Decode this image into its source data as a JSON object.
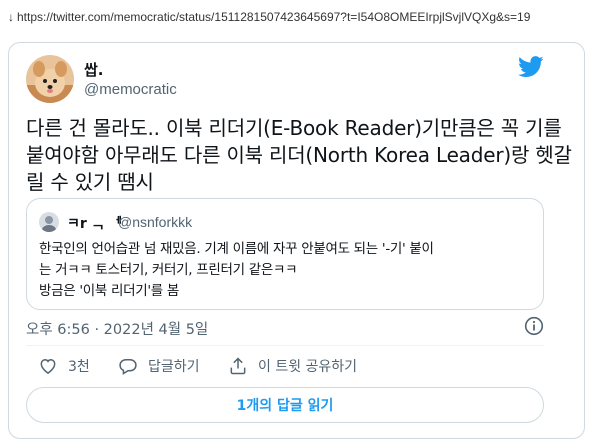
{
  "url_bar": {
    "arrow": "↓",
    "url": "https://twitter.com/memocratic/status/1511281507423645697?t=I54O8OMEEIrpjlSvjlVQXg&s=19"
  },
  "tweet": {
    "author_name": "쌉.",
    "author_handle": "@memocratic",
    "text": "다른 건 몰라도.. 이북 리더기(E-Book Reader)기만큼은 꼭 기를 붙여야함 아무래도 다른 이북 리더(North Korea Leader)랑 헷갈릴 수 있기 땜시",
    "timestamp": "오후 6:56 · 2022년 4월 5일",
    "like_count": "3천",
    "reply_label": "답글하기",
    "share_label": "이 트윗 공유하기",
    "read_replies_label": "1개의 답글 읽기"
  },
  "quoted_tweet": {
    "author_name": "ㅋr ᆨ ᅦ",
    "author_handle": "@nsnforkkk",
    "lines": [
      "한국인의 언어습관 넘 재밌음. 기계 이름에 자꾸 안붙여도 되는 '-기' 붙이",
      "는 거ㅋㅋ 토스터기, 커터기, 프린터기 같은ㅋㅋ",
      "방금은 '이북 리더기'를 봄"
    ]
  },
  "icons": {
    "brand": "twitter-bird-icon",
    "info": "info-icon",
    "like": "heart-icon",
    "reply": "speech-bubble-icon",
    "share": "share-icon"
  },
  "colors": {
    "accent": "#1d9bf0",
    "secondary_text": "#536471",
    "border": "#cfd9de"
  }
}
